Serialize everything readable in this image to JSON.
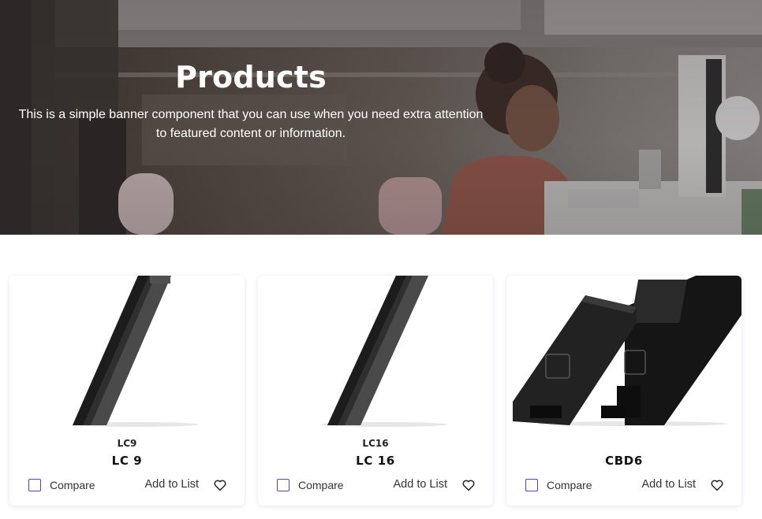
{
  "banner": {
    "title": "Products",
    "description_line1": "This is a simple banner component that you can use when you need extra attention",
    "description_line2": "to featured content or information."
  },
  "products": [
    {
      "sku": "LC9",
      "name": "LC 9",
      "compare_label": "Compare",
      "add_label": "Add to List",
      "compare_checked": false
    },
    {
      "sku": "LC16",
      "name": "LC 16",
      "compare_label": "Compare",
      "add_label": "Add to List",
      "compare_checked": false
    },
    {
      "sku": "",
      "name": "CBD6",
      "compare_label": "Compare",
      "add_label": "Add to List",
      "compare_checked": false
    }
  ],
  "colors": {
    "accent": "#5a3fc0",
    "text": "#333333",
    "banner_text": "#ffffff"
  },
  "icons": {
    "favorite": "heart-icon",
    "compare": "checkbox"
  }
}
